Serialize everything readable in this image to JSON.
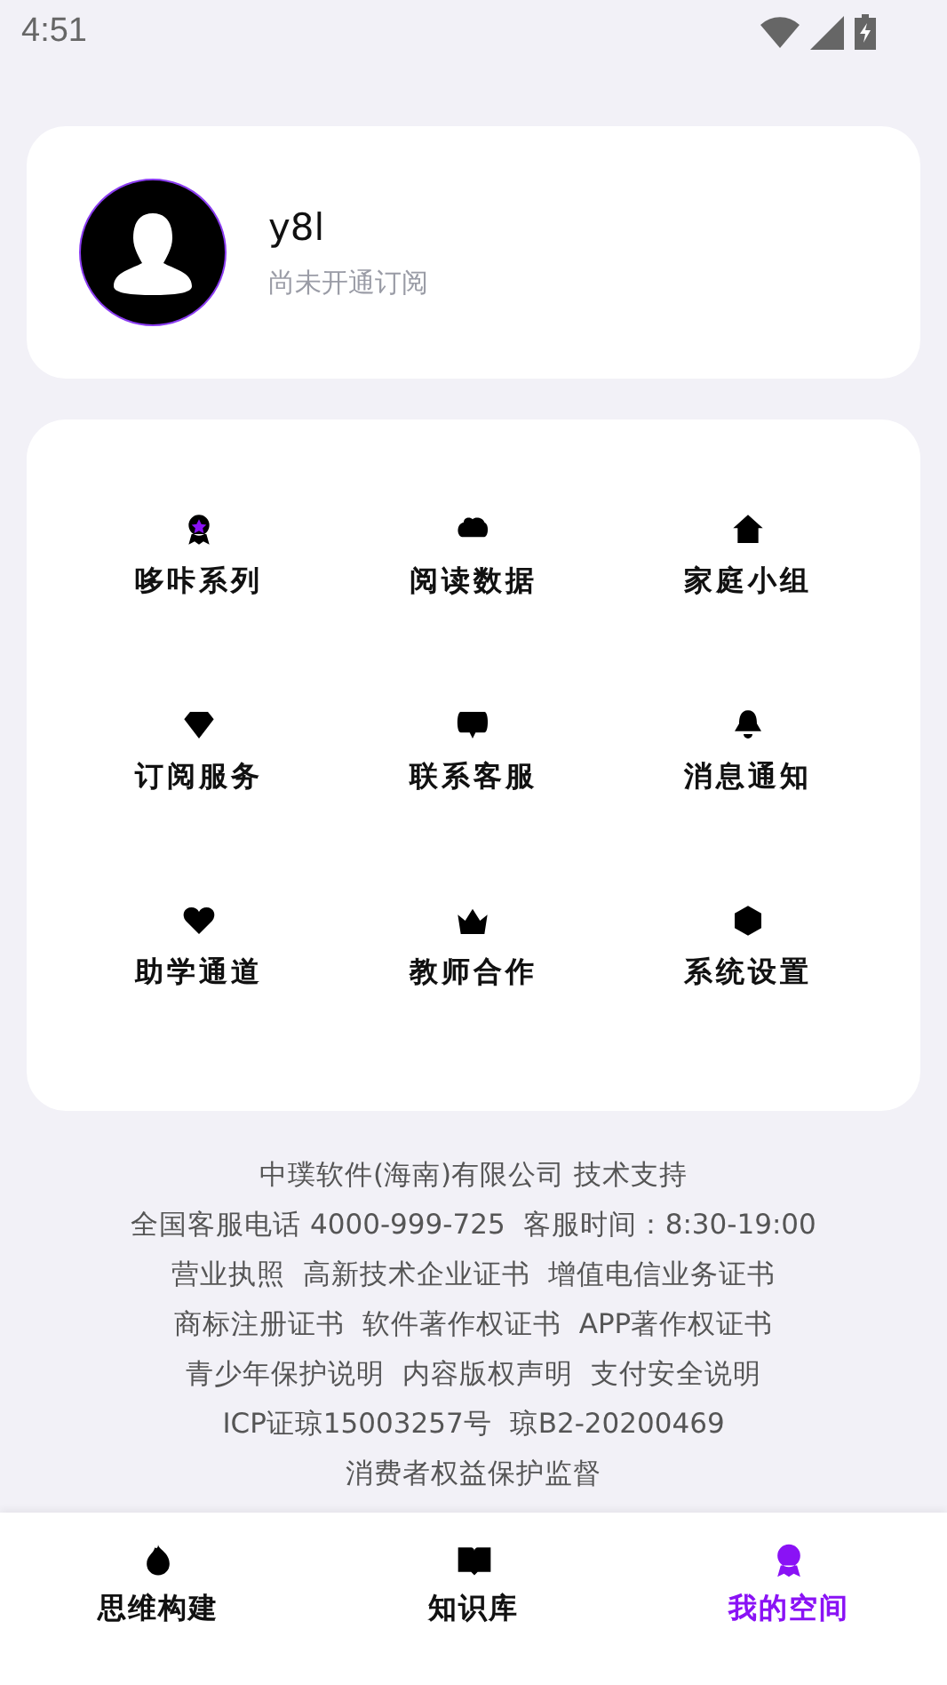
{
  "status_bar": {
    "time": "4:51"
  },
  "profile": {
    "name": "y8l",
    "subscription": "尚未开通订阅"
  },
  "menu": [
    {
      "label": "哆咔系列"
    },
    {
      "label": "阅读数据"
    },
    {
      "label": "家庭小组"
    },
    {
      "label": "订阅服务"
    },
    {
      "label": "联系客服"
    },
    {
      "label": "消息通知"
    },
    {
      "label": "助学通道"
    },
    {
      "label": "教师合作"
    },
    {
      "label": "系统设置"
    }
  ],
  "footer": {
    "lines": [
      [
        "中璞软件(海南)有限公司 技术支持"
      ],
      [
        "全国客服电话 4000-999-725",
        "客服时间：8:30-19:00"
      ],
      [
        "营业执照",
        "高新技术企业证书",
        "增值电信业务证书"
      ],
      [
        "商标注册证书",
        "软件著作权证书",
        "APP著作权证书"
      ],
      [
        "青少年保护说明",
        "内容版权声明",
        "支付安全说明"
      ],
      [
        "ICP证琼15003257号",
        "琼B2-20200469"
      ],
      [
        "消费者权益保护监督"
      ]
    ]
  },
  "tabs": [
    {
      "label": "思维构建",
      "selected": false
    },
    {
      "label": "知识库",
      "selected": false
    },
    {
      "label": "我的空间",
      "selected": true
    }
  ]
}
